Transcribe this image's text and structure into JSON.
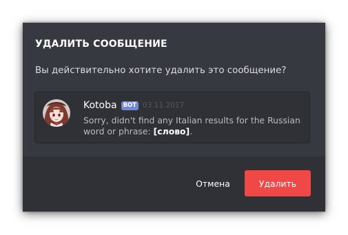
{
  "modal": {
    "title": "УДАЛИТЬ СООБЩЕНИЕ",
    "description": "Вы действительно хотите удалить это сообщение?"
  },
  "message": {
    "author": "Kotoba",
    "badge": "BOT",
    "timestamp": "03.11.2017",
    "text_before": "Sorry, didn't find any Italian results for the Russian word or phrase: ",
    "text_bold": "[слово]",
    "text_after": ".",
    "avatar_icon": "anime-girl-avatar"
  },
  "footer": {
    "cancel_label": "Отмена",
    "delete_label": "Удалить"
  },
  "colors": {
    "modal_bg": "#36393f",
    "footer_bg": "#2f3136",
    "bot_badge": "#7289da",
    "danger": "#f04747"
  }
}
